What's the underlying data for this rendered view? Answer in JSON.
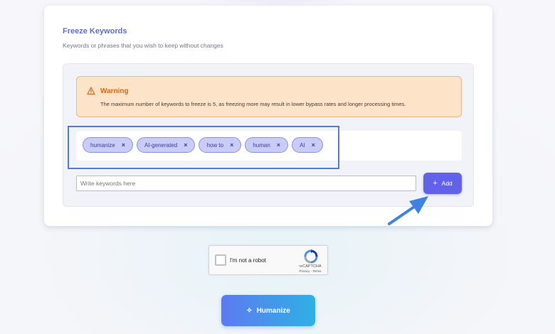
{
  "freeze": {
    "title": "Freeze Keywords",
    "subtitle": "Keywords or phrases that you wish to keep without changes"
  },
  "warning": {
    "icon": "warning-triangle-icon",
    "title": "Warning",
    "text": "The maximum number of keywords to freeze is 5, as freezing more may result in lower bypass rates and longer processing times."
  },
  "tags": [
    {
      "label": "humanize"
    },
    {
      "label": "AI-generated"
    },
    {
      "label": "how to"
    },
    {
      "label": "human"
    },
    {
      "label": "AI"
    }
  ],
  "tag_remove_symbol": "×",
  "keyword_input": {
    "placeholder": "Write keywords here",
    "value": ""
  },
  "add_button": {
    "icon": "+",
    "label": "Add"
  },
  "captcha": {
    "label": "I'm not a robot",
    "brand": "reCAPTCHA",
    "links": "Privacy - Terms"
  },
  "humanize_button": {
    "icon": "✧",
    "label": "Humanize"
  },
  "colors": {
    "accent": "#6262e8",
    "title": "#5b6fd1",
    "warning_bg": "#fde3c8",
    "warning_title": "#d06a1a",
    "tag_bg": "#c9ccf7",
    "highlight": "#4a7ed8"
  }
}
